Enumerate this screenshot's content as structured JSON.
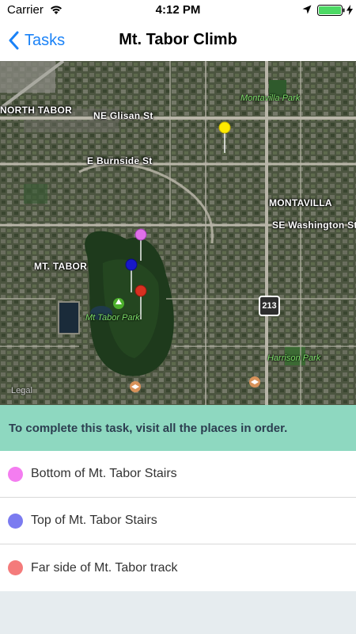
{
  "status_bar": {
    "carrier": "Carrier",
    "time": "4:12 PM",
    "icons": [
      "wifi-icon",
      "location-arrow-icon",
      "battery-icon",
      "charging-bolt-icon"
    ],
    "battery_color": "#4cd964"
  },
  "nav": {
    "back_label": "Tasks",
    "title": "Mt. Tabor Climb",
    "accent_color": "#1a82f7"
  },
  "map": {
    "streets": [
      "NE Glisan St",
      "E Burnside St",
      "SE Washington St"
    ],
    "neighborhoods": [
      "NORTH TABOR",
      "MONTAVILLA",
      "MT. TABOR"
    ],
    "parks": [
      "Montavilla Park",
      "Mt Tabor Park",
      "Harrison Park"
    ],
    "highway_shield": "213",
    "legal": "Legal",
    "pins": [
      {
        "name": "yellow-pin",
        "color": "#ffeb00"
      },
      {
        "name": "magenta-pin",
        "color": "#e070e8"
      },
      {
        "name": "blue-pin",
        "color": "#1818c8"
      },
      {
        "name": "red-pin",
        "color": "#d83020"
      }
    ]
  },
  "banner": {
    "text": "To complete this task, visit all the places in order.",
    "color": "#8ed8c0"
  },
  "places": [
    {
      "label": "Bottom of Mt. Tabor Stairs",
      "color": "#f47df0"
    },
    {
      "label": "Top of Mt. Tabor Stairs",
      "color": "#7b7bf0"
    },
    {
      "label": "Far side of Mt. Tabor track",
      "color": "#f47b7b"
    }
  ]
}
